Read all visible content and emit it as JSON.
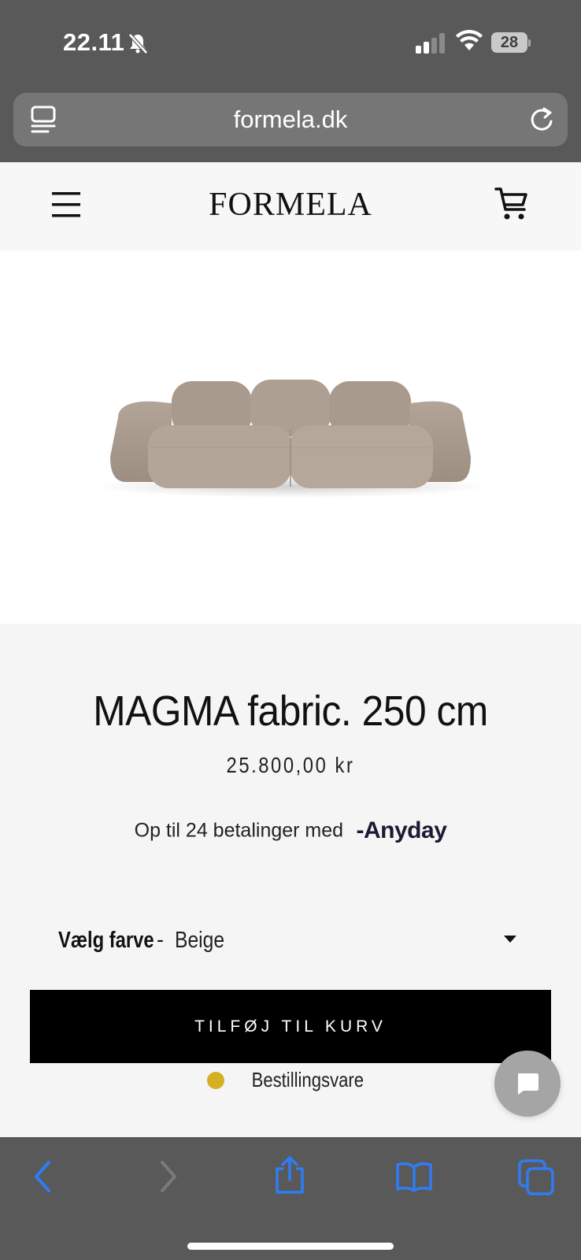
{
  "status_bar": {
    "time": "22.11",
    "battery": "28"
  },
  "browser": {
    "url": "formela.dk"
  },
  "site": {
    "logo": "FORMELA"
  },
  "product": {
    "title": "MAGMA fabric. 250 cm",
    "price": "25.800,00 kr",
    "installment_text": "Op til 24 betalinger med",
    "installment_provider": "-Anyday",
    "color_label": "Vælg farve",
    "color_separator": "-",
    "color_value": "Beige",
    "add_to_cart_label": "TILFØJ TIL KURV",
    "stock_status": "Bestillingsvare",
    "stock_color": "#d4b022"
  },
  "colors": {
    "chrome": "#595959",
    "accent": "#2f7cf6",
    "button": "#000000"
  }
}
